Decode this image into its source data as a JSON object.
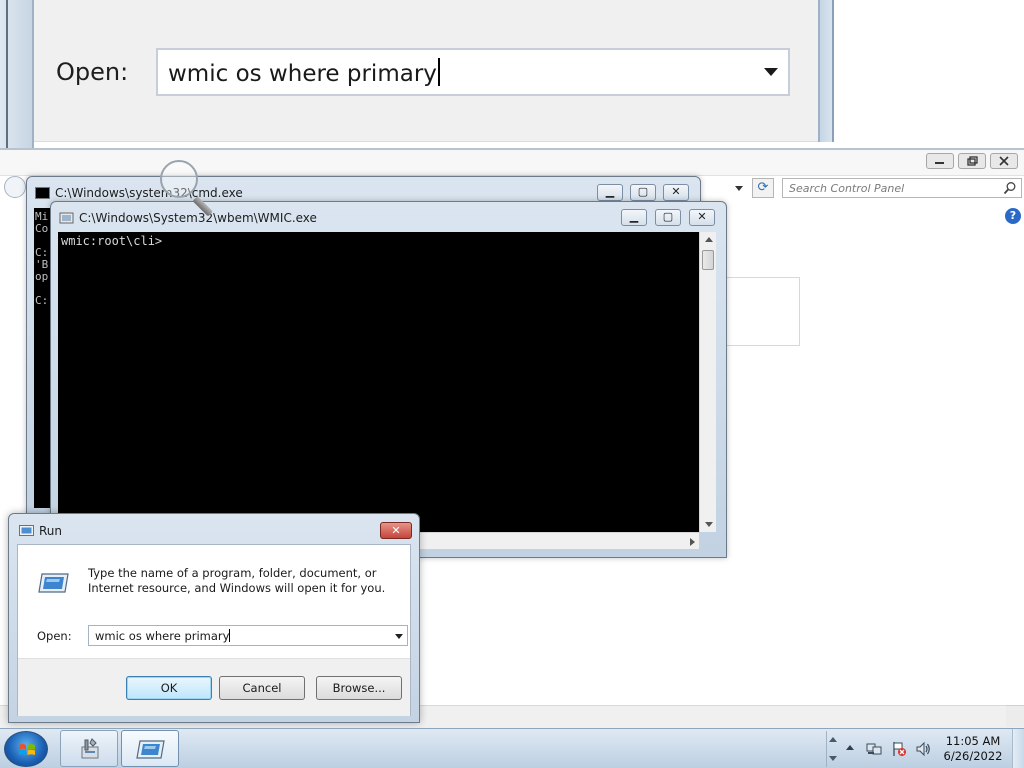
{
  "magnifier": {
    "open_label": "Open:",
    "command_text": "wmic os where primary"
  },
  "control_panel": {
    "search_placeholder": "Search Control Panel",
    "help_glyph": "?",
    "refresh_glyph": "⟳"
  },
  "cmd_window": {
    "title": "C:\\Windows\\system32\\cmd.exe",
    "lines": "Mi\nCo\n\nC:\n'B\nop\n\nC:"
  },
  "wmic_window": {
    "title": "C:\\Windows\\System32\\wbem\\WMIC.exe",
    "prompt": "wmic:root\\cli>"
  },
  "run_dialog": {
    "title": "Run",
    "close_glyph": "✕",
    "description": "Type the name of a program, folder, document, or Internet resource, and Windows will open it for you.",
    "open_label": "Open:",
    "command_text": "wmic os where primary",
    "ok_label": "OK",
    "cancel_label": "Cancel",
    "browse_label": "Browse..."
  },
  "window_controls": {
    "minimize": "▁",
    "maximize": "▢",
    "close": "✕"
  },
  "taskbar": {
    "clock_time": "11:05 AM",
    "clock_date": "6/26/2022",
    "items": [
      {
        "icon": "control-panel-tools-icon"
      },
      {
        "icon": "run-dialog-icon"
      }
    ],
    "tray_icons": [
      "network-icon",
      "action-center-flag-icon",
      "volume-icon"
    ]
  },
  "colors": {
    "console_bg": "#000000",
    "window_frame": "#c2d2e2",
    "close_red": "#c6453a",
    "taskbar": "#bccfe2"
  }
}
